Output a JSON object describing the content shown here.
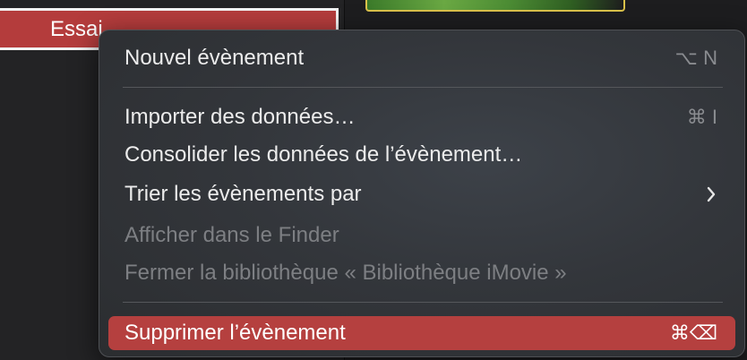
{
  "sidebar": {
    "event_label": "Essai"
  },
  "menu": {
    "items": [
      {
        "label": "Nouvel évènement",
        "shortcut": "⌥ N",
        "enabled": true
      },
      {
        "label": "Importer des données…",
        "shortcut": "⌘ I",
        "enabled": true
      },
      {
        "label": "Consolider les données de l’évènement…",
        "shortcut": "",
        "enabled": true
      },
      {
        "label": "Trier les évènements par",
        "shortcut": "",
        "enabled": true,
        "submenu": true
      },
      {
        "label": "Afficher dans le Finder",
        "shortcut": "",
        "enabled": false
      },
      {
        "label": "Fermer la bibliothèque « Bibliothèque iMovie »",
        "shortcut": "",
        "enabled": false
      },
      {
        "label": "Supprimer l’évènement",
        "shortcut": "⌘⌫",
        "enabled": true,
        "highlighted": true
      }
    ]
  },
  "colors": {
    "accent": "#b5403f",
    "menu_background": "#33363b",
    "disabled_text": "#7d7f83"
  },
  "icons": {
    "submenu": "chevron-right-icon",
    "option_key": "option-key-icon",
    "command_key": "command-key-icon",
    "delete_key": "delete-key-icon"
  }
}
